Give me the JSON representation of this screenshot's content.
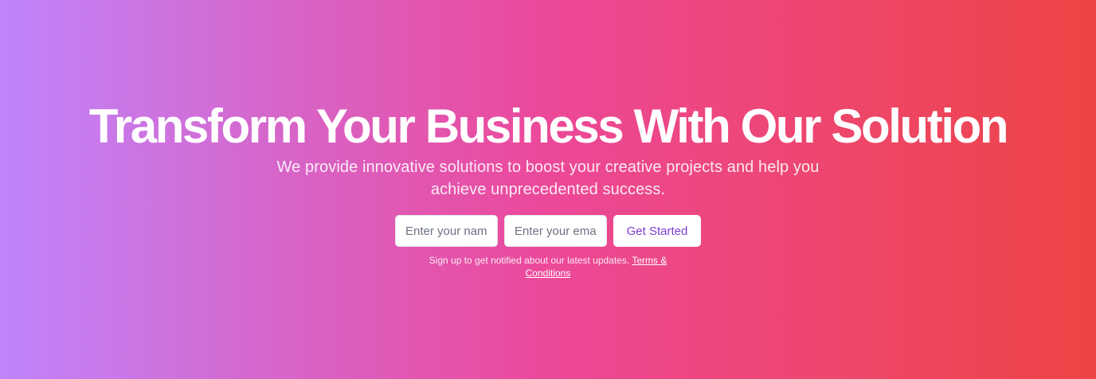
{
  "hero": {
    "title": "Transform Your Business With Our Solution",
    "subtitle": "We provide innovative solutions to boost your creative projects and help you achieve unprecedented success.",
    "form": {
      "name_placeholder": "Enter your name",
      "email_placeholder": "Enter your email",
      "submit_label": "Get Started"
    },
    "note": {
      "text": "Sign up to get notified about our latest updates.",
      "link_label": "Terms & Conditions"
    }
  },
  "colors": {
    "gradient_start": "#c084fc",
    "gradient_mid": "#ec4899",
    "gradient_end": "#ef4444",
    "button_text": "#7e3dd6"
  }
}
